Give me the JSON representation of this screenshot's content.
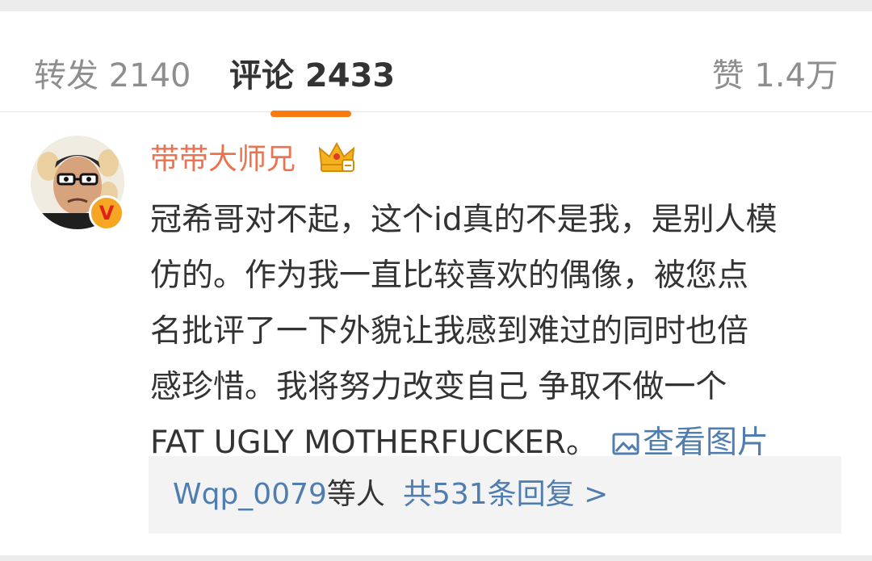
{
  "tabs": {
    "repost": "转发 2140",
    "comments": "评论 2433",
    "likes": "赞 1.4万",
    "active": "comments",
    "accent_color": "#f77b0f"
  },
  "comment": {
    "username": "带带大师兄",
    "username_color": "#eb7350",
    "badges": [
      "crown-vip-icon",
      "verified-v-icon"
    ],
    "verified_mark": "V",
    "lines": [
      "冠希哥对不起，这个id真的不是我，是别人模",
      "仿的。作为我一直比较喜欢的偶像，被您点",
      "名批评了一下外貌让我感到难过的同时也倍",
      "感珍惜。我将努力改变自己 争取不做一个",
      "FAT UGLY MOTHERFUCKER。"
    ],
    "view_image_label": "查看图片",
    "link_color": "#507daf"
  },
  "replies": {
    "user": "Wqp_0079",
    "others": "等人",
    "count_label": "共531条回复 >"
  }
}
